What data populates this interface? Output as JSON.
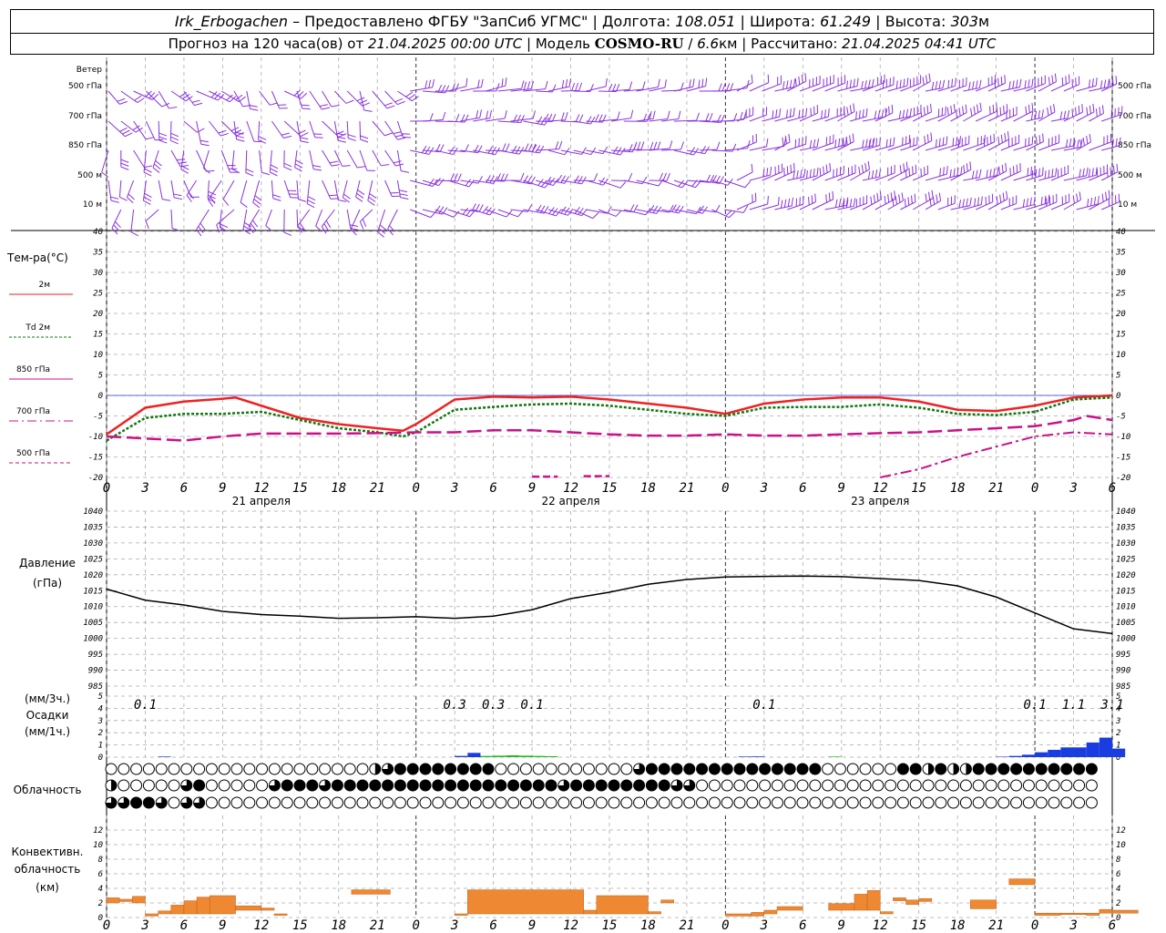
{
  "header": {
    "station": "Irk_Erbogachen",
    "provider": "– Предоставлено ФГБУ \"ЗапСиб УГМС\"",
    "lon_label": "Долгота:",
    "lon": "108.051",
    "lat_label": "Широта:",
    "lat": "61.249",
    "alt_label": "Высота:",
    "alt": "303",
    "alt_unit": "м",
    "forecast_label": "Прогноз на 120 часа(ов) от",
    "forecast_time": "21.04.2025 00:00 UTC",
    "model_label": "Модель",
    "model": "COSMO-RU",
    "model_res": "6.6",
    "model_res_unit": "км",
    "calc_label": "Рассчитано:",
    "calc_time": "21.04.2025 04:41 UTC"
  },
  "labels": {
    "wind_title": "Ветер",
    "wind_levels": [
      "500 гПа",
      "700 гПа",
      "850 гПа",
      "500 м",
      "10 м"
    ],
    "temp_title": "Тем-ра(°С)",
    "legend": [
      {
        "text": "2м",
        "color": "#ee2222",
        "dash": ""
      },
      {
        "text": "Td 2м",
        "color": "#117711",
        "dash": "3,2"
      },
      {
        "text": "850 гПа",
        "color": "#cc1188",
        "dash": ""
      },
      {
        "text": "700 гПа",
        "color": "#cc1188",
        "dash": "10,4,2,4"
      },
      {
        "text": "500 гПа",
        "color": "#cc1188",
        "dash": "4,3"
      }
    ],
    "pressure_title": "Давление",
    "pressure_unit": "(гПа)",
    "precip_unit_top": "(мм/3ч.)",
    "precip_title": "Осадки",
    "precip_unit_bottom": "(мм/1ч.)",
    "cloud_title": "Облачность",
    "conv_title_1": "Конвективн.",
    "conv_title_2": "облачность",
    "conv_unit": "(км)"
  },
  "chart_data": [
    {
      "type": "line",
      "name": "temperature",
      "x_hours": [
        0,
        3,
        6,
        9,
        12,
        15,
        18,
        21,
        24,
        27,
        30,
        33,
        36,
        39,
        42,
        45,
        48,
        51,
        54,
        57,
        60,
        63,
        66,
        69,
        72,
        75,
        78
      ],
      "xticks": [
        "0",
        "3",
        "6",
        "9",
        "12",
        "15",
        "18",
        "21",
        "0",
        "3",
        "6",
        "9",
        "12",
        "15",
        "18",
        "21",
        "0",
        "3",
        "6",
        "9",
        "12",
        "15",
        "18",
        "21",
        "0",
        "3",
        "6"
      ],
      "day_labels": [
        "21 апреля",
        "22 апреля",
        "23 апреля"
      ],
      "ylim": [
        -20,
        40
      ],
      "yticks": [
        40,
        35,
        30,
        25,
        20,
        15,
        10,
        5,
        0,
        -5,
        -10,
        -15,
        -20
      ],
      "series": [
        {
          "name": "2м",
          "color": "#ee2222",
          "x": [
            0,
            3,
            6,
            9,
            10,
            12,
            15,
            18,
            21,
            23,
            24,
            27,
            30,
            33,
            36,
            39,
            42,
            45,
            48,
            51,
            54,
            57,
            60,
            63,
            66,
            69,
            72,
            75,
            78
          ],
          "y": [
            -9.5,
            -3,
            -1.5,
            -0.8,
            -0.5,
            -2.5,
            -5.5,
            -7,
            -8,
            -8.6,
            -7,
            -1,
            -0.3,
            -0.5,
            -0.3,
            -1,
            -2,
            -3,
            -4.5,
            -2,
            -1,
            -0.5,
            -0.5,
            -1.5,
            -3.5,
            -3.8,
            -2.5,
            -0.5,
            0
          ]
        },
        {
          "name": "Td 2м",
          "color": "#117711",
          "x": [
            0,
            3,
            6,
            9,
            12,
            15,
            18,
            21,
            23,
            24,
            27,
            30,
            33,
            36,
            39,
            42,
            45,
            48,
            51,
            54,
            57,
            60,
            63,
            66,
            69,
            72,
            75,
            78
          ],
          "y": [
            -11,
            -5.5,
            -4.5,
            -4.5,
            -4,
            -6,
            -8,
            -9,
            -10,
            -9,
            -3.5,
            -2.8,
            -2.2,
            -2,
            -2.5,
            -3.5,
            -4.5,
            -5,
            -3,
            -2.8,
            -2.8,
            -2.2,
            -3,
            -4.5,
            -4.8,
            -4,
            -1,
            -0.5
          ]
        },
        {
          "name": "850 гПа",
          "color": "#cc1188",
          "x": [
            0,
            3,
            6,
            9,
            12,
            15,
            18,
            21,
            24,
            27,
            30,
            33,
            36,
            39,
            42,
            45,
            48,
            51,
            54,
            57,
            60,
            63,
            66,
            69,
            72,
            75,
            76,
            78
          ],
          "y": [
            -10,
            -10.5,
            -11,
            -10,
            -9.3,
            -9.3,
            -9.3,
            -9.2,
            -9,
            -9,
            -8.5,
            -8.5,
            -9,
            -9.5,
            -9.8,
            -9.8,
            -9.5,
            -9.8,
            -9.8,
            -9.5,
            -9.2,
            -9,
            -8.5,
            -8,
            -7.5,
            -6,
            -5,
            -6
          ]
        },
        {
          "name": "700 гПа",
          "color": "#cc1188",
          "x": [
            60,
            63,
            66,
            69,
            72,
            75,
            78
          ],
          "y": [
            -20,
            -18,
            -15,
            -12.5,
            -10,
            -9,
            -9.5
          ]
        }
      ]
    },
    {
      "type": "line",
      "name": "pressure",
      "ylim": [
        985,
        1040
      ],
      "yticks": [
        1040,
        1035,
        1030,
        1025,
        1020,
        1015,
        1010,
        1005,
        1000,
        995,
        990,
        985
      ],
      "x": [
        0,
        3,
        6,
        9,
        12,
        15,
        18,
        21,
        24,
        27,
        30,
        33,
        36,
        39,
        42,
        45,
        48,
        51,
        54,
        57,
        60,
        63,
        66,
        69,
        72,
        75,
        78
      ],
      "y": [
        1015.5,
        1012,
        1010.5,
        1008.5,
        1007.5,
        1007,
        1006.3,
        1006.5,
        1006.8,
        1006.3,
        1007,
        1009,
        1012.5,
        1014.5,
        1017,
        1018.5,
        1019.3,
        1019.5,
        1019.6,
        1019.4,
        1018.8,
        1018.2,
        1016.5,
        1013,
        1008,
        1003,
        1001.5
      ]
    },
    {
      "type": "bar",
      "name": "precipitation",
      "ylim": [
        0,
        5
      ],
      "yticks": [
        5,
        4,
        3,
        2,
        1,
        0
      ],
      "labels_3h": [
        {
          "x": 4.5,
          "text": "0.1"
        },
        {
          "x": 28.5,
          "text": "0.3"
        },
        {
          "x": 31.5,
          "text": "0.3"
        },
        {
          "x": 34.5,
          "text": "0.1"
        },
        {
          "x": 52.5,
          "text": "0.1"
        },
        {
          "x": 73.5,
          "text": "0.1"
        },
        {
          "x": 76.5,
          "text": "1.1"
        },
        {
          "x": 79.5,
          "text": "3.1"
        }
      ],
      "bars": [
        {
          "x": 5,
          "value": 0.05,
          "color": "#1a3de0"
        },
        {
          "x": 28,
          "value": 0.1,
          "color": "#1a3de0"
        },
        {
          "x": 29,
          "value": 0.35,
          "color": "#1a3de0"
        },
        {
          "x": 30,
          "value": 0.1,
          "color": "#22bb22"
        },
        {
          "x": 31,
          "value": 0.12,
          "color": "#22bb22"
        },
        {
          "x": 32,
          "value": 0.15,
          "color": "#22bb22"
        },
        {
          "x": 33,
          "value": 0.12,
          "color": "#22bb22"
        },
        {
          "x": 34,
          "value": 0.1,
          "color": "#22bb22"
        },
        {
          "x": 35,
          "value": 0.08,
          "color": "#22bb22"
        },
        {
          "x": 50,
          "value": 0.05,
          "color": "#1a3de0"
        },
        {
          "x": 51,
          "value": 0.06,
          "color": "#1a3de0"
        },
        {
          "x": 57,
          "value": 0.05,
          "color": "#22bb22"
        },
        {
          "x": 70,
          "value": 0.04,
          "color": "#1a3de0"
        },
        {
          "x": 71,
          "value": 0.1,
          "color": "#1a3de0"
        },
        {
          "x": 72,
          "value": 0.2,
          "color": "#1a3de0"
        },
        {
          "x": 73,
          "value": 0.4,
          "color": "#1a3de0"
        },
        {
          "x": 74,
          "value": 0.6,
          "color": "#1a3de0"
        },
        {
          "x": 75,
          "value": 0.8,
          "color": "#1a3de0"
        },
        {
          "x": 76,
          "value": 0.8,
          "color": "#1a3de0"
        },
        {
          "x": 77,
          "value": 1.2,
          "color": "#1a3de0"
        },
        {
          "x": 78,
          "value": 1.6,
          "color": "#1a3de0"
        },
        {
          "x": 79,
          "value": 0.7,
          "color": "#1a3de0"
        }
      ]
    },
    {
      "type": "bar",
      "name": "convective_cloud",
      "ylim": [
        0,
        14
      ],
      "yticks": [
        12,
        10,
        8,
        6,
        4,
        2,
        0
      ],
      "color": "#ee8833",
      "bars": [
        {
          "x0": 0,
          "x1": 1,
          "low": 2.0,
          "high": 2.7
        },
        {
          "x0": 1,
          "x1": 2,
          "low": 2.2,
          "high": 2.5
        },
        {
          "x0": 2,
          "x1": 3,
          "low": 2.0,
          "high": 2.9
        },
        {
          "x0": 3,
          "x1": 4,
          "low": 0.2,
          "high": 0.5
        },
        {
          "x0": 4,
          "x1": 5,
          "low": 0.5,
          "high": 0.9
        },
        {
          "x0": 5,
          "x1": 6,
          "low": 0.5,
          "high": 1.7
        },
        {
          "x0": 6,
          "x1": 7,
          "low": 0.5,
          "high": 2.3
        },
        {
          "x0": 7,
          "x1": 8,
          "low": 0.5,
          "high": 2.8
        },
        {
          "x0": 8,
          "x1": 10,
          "low": 0.5,
          "high": 3.0
        },
        {
          "x0": 10,
          "x1": 12,
          "low": 1.0,
          "high": 1.6
        },
        {
          "x0": 12,
          "x1": 13,
          "low": 1.0,
          "high": 1.3
        },
        {
          "x0": 13,
          "x1": 14,
          "low": 0.3,
          "high": 0.5
        },
        {
          "x0": 19,
          "x1": 22,
          "low": 3.2,
          "high": 3.8
        },
        {
          "x0": 27,
          "x1": 28,
          "low": 0.3,
          "high": 0.5
        },
        {
          "x0": 28,
          "x1": 37,
          "low": 0.5,
          "high": 3.8
        },
        {
          "x0": 37,
          "x1": 38,
          "low": 0.5,
          "high": 1.0
        },
        {
          "x0": 38,
          "x1": 42,
          "low": 0.5,
          "high": 3.0
        },
        {
          "x0": 42,
          "x1": 43,
          "low": 0.5,
          "high": 0.8
        },
        {
          "x0": 43,
          "x1": 44,
          "low": 2.0,
          "high": 2.4
        },
        {
          "x0": 48,
          "x1": 50,
          "low": 0.2,
          "high": 0.5
        },
        {
          "x0": 50,
          "x1": 51,
          "low": 0.2,
          "high": 0.7
        },
        {
          "x0": 51,
          "x1": 52,
          "low": 0.5,
          "high": 1.0
        },
        {
          "x0": 52,
          "x1": 54,
          "low": 1.0,
          "high": 1.5
        },
        {
          "x0": 56,
          "x1": 58,
          "low": 1.0,
          "high": 1.9
        },
        {
          "x0": 58,
          "x1": 59,
          "low": 1.0,
          "high": 3.2
        },
        {
          "x0": 59,
          "x1": 60,
          "low": 1.0,
          "high": 3.7
        },
        {
          "x0": 60,
          "x1": 61,
          "low": 0.5,
          "high": 0.8
        },
        {
          "x0": 61,
          "x1": 62,
          "low": 2.3,
          "high": 2.7
        },
        {
          "x0": 62,
          "x1": 63,
          "low": 1.8,
          "high": 2.4
        },
        {
          "x0": 63,
          "x1": 64,
          "low": 2.2,
          "high": 2.6
        },
        {
          "x0": 67,
          "x1": 69,
          "low": 1.2,
          "high": 2.4
        },
        {
          "x0": 70,
          "x1": 72,
          "low": 4.5,
          "high": 5.3
        },
        {
          "x0": 72,
          "x1": 74,
          "low": 0.3,
          "high": 0.6
        },
        {
          "x0": 74,
          "x1": 76,
          "low": 0.4,
          "high": 0.6
        },
        {
          "x0": 76,
          "x1": 77,
          "low": 0.3,
          "high": 0.6
        },
        {
          "x0": 77,
          "x1": 78,
          "low": 0.6,
          "high": 1.1
        },
        {
          "x0": 78,
          "x1": 80,
          "low": 0.6,
          "high": 1.0
        }
      ]
    },
    {
      "type": "table",
      "name": "cloudiness",
      "note": "oktas 0-4 per 3 rows (low/middle/high), 80 columns",
      "rows": [
        "0000000000000000000002344444444000000000003444444444444440000004424224444444444",
        "2000003400000344434444444444444444443444444443300000000000000000000000000000000",
        "3344303300000000000000000000000000000000000000000000000000000000000000000000000"
      ]
    }
  ]
}
